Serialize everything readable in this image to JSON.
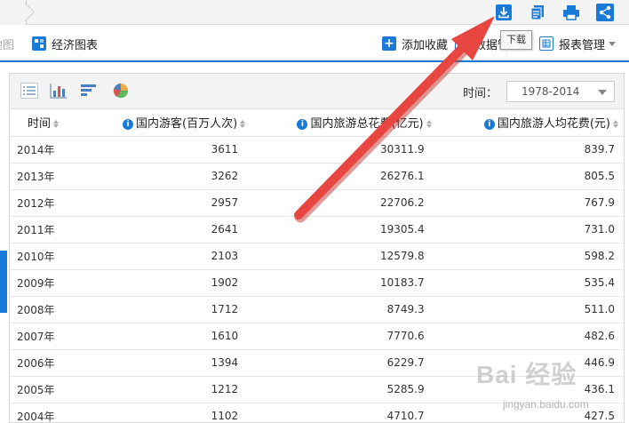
{
  "toolbar": {
    "tooltip": "下载"
  },
  "nav": {
    "map_label": "地图",
    "econ_chart_label": "经济图表",
    "add_fav_label": "添加收藏",
    "data_mgmt_label": "数据管",
    "report_mgmt_label": "报表管理"
  },
  "panel": {
    "time_label": "时间：",
    "time_range": "1978-2014"
  },
  "table": {
    "headers": [
      "时间",
      "国内游客(百万人次)",
      "国内旅游总花费(亿元)",
      "国内旅游人均花费(元)"
    ],
    "rows": [
      [
        "2014年",
        "3611",
        "30311.9",
        "839.7"
      ],
      [
        "2013年",
        "3262",
        "26276.1",
        "805.5"
      ],
      [
        "2012年",
        "2957",
        "22706.2",
        "767.9"
      ],
      [
        "2011年",
        "2641",
        "19305.4",
        "731.0"
      ],
      [
        "2010年",
        "2103",
        "12579.8",
        "598.2"
      ],
      [
        "2009年",
        "1902",
        "10183.7",
        "535.4"
      ],
      [
        "2008年",
        "1712",
        "8749.3",
        "511.0"
      ],
      [
        "2007年",
        "1610",
        "7770.6",
        "482.6"
      ],
      [
        "2006年",
        "1394",
        "6229.7",
        "446.9"
      ],
      [
        "2005年",
        "1212",
        "5285.9",
        "436.1"
      ],
      [
        "2004年",
        "1102",
        "4710.7",
        "427.5"
      ]
    ]
  },
  "watermark": {
    "logo": "Bai 经验",
    "url": "jingyan.baidu.com"
  },
  "colors": {
    "accent": "#1a7ad9",
    "arrow": "#e53935"
  }
}
